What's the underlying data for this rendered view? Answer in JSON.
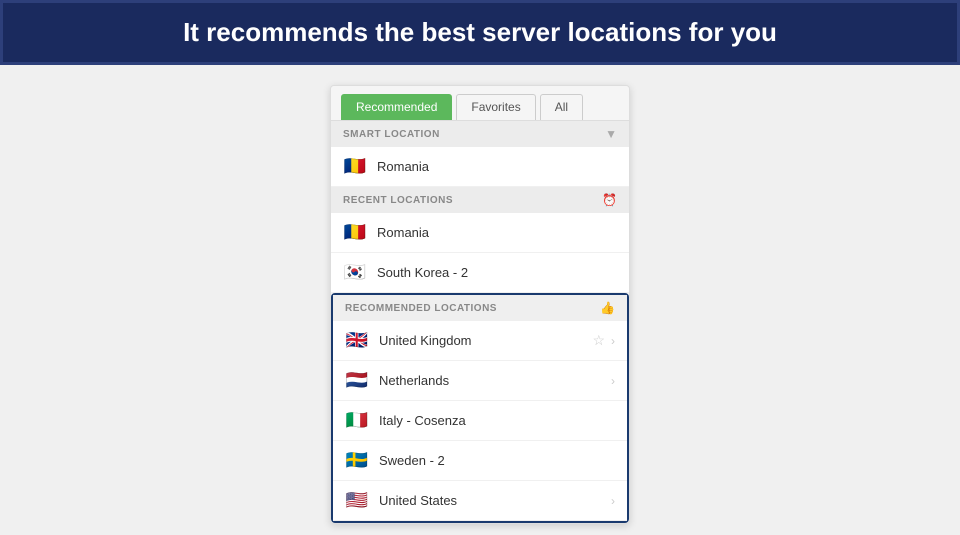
{
  "header": {
    "text": "It recommends the best server locations for you"
  },
  "tabs": [
    {
      "id": "recommended",
      "label": "Recommended",
      "active": true
    },
    {
      "id": "favorites",
      "label": "Favorites",
      "active": false
    },
    {
      "id": "all",
      "label": "All",
      "active": false
    }
  ],
  "sections": {
    "smart_location": {
      "header": "SMART LOCATION",
      "items": [
        {
          "flag": "🇷🇴",
          "name": "Romania"
        }
      ]
    },
    "recent_locations": {
      "header": "RECENT LOCATIONS",
      "items": [
        {
          "flag": "🇷🇴",
          "name": "Romania"
        },
        {
          "flag": "🇰🇷",
          "name": "South Korea - 2"
        }
      ]
    },
    "recommended_locations": {
      "header": "RECOMMENDED LOCATIONS",
      "items": [
        {
          "flag": "🇬🇧",
          "name": "United Kingdom",
          "has_chevron": true,
          "has_star": true
        },
        {
          "flag": "🇳🇱",
          "name": "Netherlands",
          "has_chevron": true
        },
        {
          "flag": "🇮🇹",
          "name": "Italy - Cosenza",
          "has_chevron": false
        },
        {
          "flag": "🇸🇪",
          "name": "Sweden - 2",
          "has_chevron": false
        },
        {
          "flag": "🇺🇸",
          "name": "United States",
          "has_chevron": true
        }
      ]
    }
  }
}
